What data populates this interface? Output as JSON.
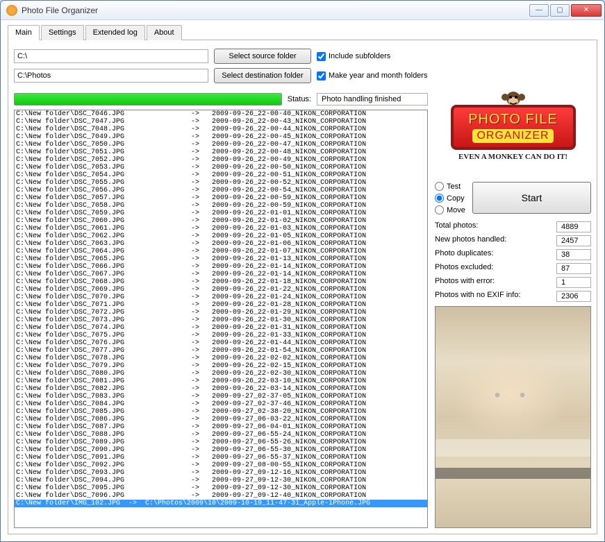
{
  "window": {
    "title": "Photo File Organizer"
  },
  "tabs": [
    {
      "label": "Main",
      "active": true
    },
    {
      "label": "Settings",
      "active": false
    },
    {
      "label": "Extended log",
      "active": false
    },
    {
      "label": "About",
      "active": false
    }
  ],
  "sourcePath": "C:\\",
  "destPath": "C:\\Photos",
  "buttons": {
    "selectSource": "Select source folder",
    "selectDest": "Select destination folder",
    "start": "Start"
  },
  "checkboxes": {
    "includeSubfolders": {
      "label": "Include subfolders",
      "checked": true
    },
    "makeYearMonth": {
      "label": "Make year and month folders",
      "checked": true
    }
  },
  "statusLabel": "Status:",
  "statusValue": "Photo handling finished",
  "logo": {
    "line1": "PHOTO FILE",
    "line2": "ORGANIZER",
    "tagline": "EVEN A MONKEY CAN DO IT!"
  },
  "mode": {
    "options": [
      {
        "label": "Test",
        "value": "test",
        "checked": false
      },
      {
        "label": "Copy",
        "value": "copy",
        "checked": true
      },
      {
        "label": "Move",
        "value": "move",
        "checked": false
      }
    ]
  },
  "stats": {
    "totalLabel": "Total photos:",
    "totalValue": "4889",
    "newLabel": "New photos handled:",
    "newValue": "2457",
    "dupLabel": "Photo duplicates:",
    "dupValue": "38",
    "exclLabel": "Photos excluded:",
    "exclValue": "87",
    "errLabel": "Photos with error:",
    "errValue": "1",
    "noexifLabel": "Photos with no EXIF info:",
    "noexifValue": "2306"
  },
  "log": [
    "C:\\New folder\\DSC_7046.JPG                ->   2009-09-26_22-00-40_NIKON_CORPORATION",
    "C:\\New folder\\DSC_7047.JPG                ->   2009-09-26_22-00-43_NIKON_CORPORATION",
    "C:\\New folder\\DSC_7048.JPG                ->   2009-09-26_22-00-44_NIKON_CORPORATION",
    "C:\\New folder\\DSC_7049.JPG                ->   2009-09-26_22-00-45_NIKON_CORPORATION",
    "C:\\New folder\\DSC_7050.JPG                ->   2009-09-26_22-00-47_NIKON_CORPORATION",
    "C:\\New folder\\DSC_7051.JPG                ->   2009-09-26_22-00-48_NIKON_CORPORATION",
    "C:\\New folder\\DSC_7052.JPG                ->   2009-09-26_22-00-49_NIKON_CORPORATION",
    "C:\\New folder\\DSC_7053.JPG                ->   2009-09-26_22-00-50_NIKON_CORPORATION",
    "C:\\New folder\\DSC_7054.JPG                ->   2009-09-26_22-00-51_NIKON_CORPORATION",
    "C:\\New folder\\DSC_7055.JPG                ->   2009-09-26_22-00-52_NIKON_CORPORATION",
    "C:\\New folder\\DSC_7056.JPG                ->   2009-09-26_22-00-54_NIKON_CORPORATION",
    "C:\\New folder\\DSC_7057.JPG                ->   2009-09-26_22-00-59_NIKON_CORPORATION",
    "C:\\New folder\\DSC_7058.JPG                ->   2009-09-26_22-00-59_NIKON_CORPORATION",
    "C:\\New folder\\DSC_7059.JPG                ->   2009-09-26_22-01-01_NIKON_CORPORATION",
    "C:\\New folder\\DSC_7060.JPG                ->   2009-09-26_22-01-02_NIKON_CORPORATION",
    "C:\\New folder\\DSC_7061.JPG                ->   2009-09-26_22-01-03_NIKON_CORPORATION",
    "C:\\New folder\\DSC_7062.JPG                ->   2009-09-26_22-01-05_NIKON_CORPORATION",
    "C:\\New folder\\DSC_7063.JPG                ->   2009-09-26_22-01-06_NIKON_CORPORATION",
    "C:\\New folder\\DSC_7064.JPG                ->   2009-09-26_22-01-07_NIKON_CORPORATION",
    "C:\\New folder\\DSC_7065.JPG                ->   2009-09-26_22-01-13_NIKON_CORPORATION",
    "C:\\New folder\\DSC_7066.JPG                ->   2009-09-26_22-01-14_NIKON_CORPORATION",
    "C:\\New folder\\DSC_7067.JPG                ->   2009-09-26_22-01-14_NIKON_CORPORATION",
    "C:\\New folder\\DSC_7068.JPG                ->   2009-09-26_22-01-18_NIKON_CORPORATION",
    "C:\\New folder\\DSC_7069.JPG                ->   2009-09-26_22-01-22_NIKON_CORPORATION",
    "C:\\New folder\\DSC_7070.JPG                ->   2009-09-26_22-01-24_NIKON_CORPORATION",
    "C:\\New folder\\DSC_7071.JPG                ->   2009-09-26_22-01-28_NIKON_CORPORATION",
    "C:\\New folder\\DSC_7072.JPG                ->   2009-09-26_22-01-29_NIKON_CORPORATION",
    "C:\\New folder\\DSC_7073.JPG                ->   2009-09-26_22-01-30_NIKON_CORPORATION",
    "C:\\New folder\\DSC_7074.JPG                ->   2009-09-26_22-01-31_NIKON_CORPORATION",
    "C:\\New folder\\DSC_7075.JPG                ->   2009-09-26_22-01-33_NIKON_CORPORATION",
    "C:\\New folder\\DSC_7076.JPG                ->   2009-09-26_22-01-44_NIKON_CORPORATION",
    "C:\\New folder\\DSC_7077.JPG                ->   2009-09-26_22-01-54_NIKON_CORPORATION",
    "C:\\New folder\\DSC_7078.JPG                ->   2009-09-26_22-02-02_NIKON_CORPORATION",
    "C:\\New folder\\DSC_7079.JPG                ->   2009-09-26_22-02-15_NIKON_CORPORATION",
    "C:\\New folder\\DSC_7080.JPG                ->   2009-09-26_22-02-30_NIKON_CORPORATION",
    "C:\\New folder\\DSC_7081.JPG                ->   2009-09-26_22-03-10_NIKON_CORPORATION",
    "C:\\New folder\\DSC_7082.JPG                ->   2009-09-26_22-03-14_NIKON_CORPORATION",
    "C:\\New folder\\DSC_7083.JPG                ->   2009-09-27_02-37-05_NIKON_CORPORATION",
    "C:\\New folder\\DSC_7084.JPG                ->   2009-09-27_02-37-46_NIKON_CORPORATION",
    "C:\\New folder\\DSC_7085.JPG                ->   2009-09-27_02-38-20_NIKON_CORPORATION",
    "C:\\New folder\\DSC_7086.JPG                ->   2009-09-27_06-03-22_NIKON_CORPORATION",
    "C:\\New folder\\DSC_7087.JPG                ->   2009-09-27_06-04-01_NIKON_CORPORATION",
    "C:\\New folder\\DSC_7088.JPG                ->   2009-09-27_06-55-24_NIKON_CORPORATION",
    "C:\\New folder\\DSC_7089.JPG                ->   2009-09-27_06-55-26_NIKON_CORPORATION",
    "C:\\New folder\\DSC_7090.JPG                ->   2009-09-27_06-55-30_NIKON_CORPORATION",
    "C:\\New folder\\DSC_7091.JPG                ->   2009-09-27_06-55-37_NIKON_CORPORATION",
    "C:\\New folder\\DSC_7092.JPG                ->   2009-09-27_08-00-55_NIKON_CORPORATION",
    "C:\\New folder\\DSC_7093.JPG                ->   2009-09-27_09-12-16_NIKON_CORPORATION",
    "C:\\New folder\\DSC_7094.JPG                ->   2009-09-27_09-12-30_NIKON_CORPORATION",
    "C:\\New folder\\DSC_7095.JPG                ->   2009-09-27_09-12-30_NIKON_CORPORATION",
    "C:\\New folder\\DSC_7096.JPG                ->   2009-09-27_09-12-40_NIKON_CORPORATION"
  ],
  "logSelected": "C:\\New folder\\IMG_102.JPG  ->  C:\\Photos\\2009\\10\\2009-10-19_11-47-31_Apple-iPhone.JPG"
}
